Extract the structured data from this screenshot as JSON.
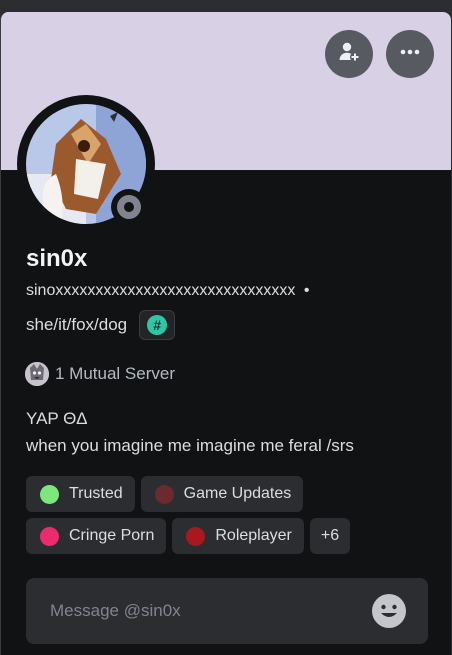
{
  "profile": {
    "display_name": "sin0x",
    "username": "sinoxxxxxxxxxxxxxxxxxxxxxxxxxxxxxx",
    "separator": "•",
    "pronouns": "she/it/fox/dog",
    "badge_symbol": "#"
  },
  "mutual": {
    "label": "1 Mutual Server"
  },
  "bio": {
    "line1": "YAP ΘΔ",
    "line2": "when you imagine me imagine me feral /srs"
  },
  "roles": [
    {
      "name": "Trusted",
      "color": "#7ee77c"
    },
    {
      "name": "Game Updates",
      "color": "#6b2a2e"
    },
    {
      "name": "Cringe Porn",
      "color": "#ec2a6e"
    },
    {
      "name": "Roleplayer",
      "color": "#a8191e"
    }
  ],
  "roles_more": "+6",
  "message": {
    "placeholder": "Message @sin0x"
  },
  "icons": {
    "add_friend": "add-friend-icon",
    "more": "more-icon",
    "status": "offline-status-icon",
    "emoji": "emoji-icon"
  },
  "colors": {
    "banner": "#d8d0e4",
    "card": "#111214",
    "accent_badge": "#2dc7a6",
    "status_offline": "#80848e"
  }
}
